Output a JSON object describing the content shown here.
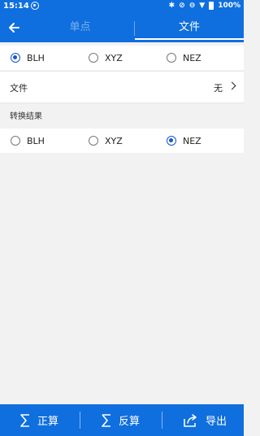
{
  "status_bar": {
    "time": "15:14",
    "battery_pct": "100%",
    "icons": [
      "sync-icon",
      "bluetooth-icon",
      "notifications-off-icon",
      "do-not-disturb-icon",
      "wifi-icon",
      "battery-icon"
    ]
  },
  "nav": {
    "tabs": [
      {
        "label": "单点",
        "active": false
      },
      {
        "label": "文件",
        "active": true
      }
    ]
  },
  "input_format": {
    "options": [
      "BLH",
      "XYZ",
      "NEZ"
    ],
    "selected": "BLH"
  },
  "file_row": {
    "label": "文件",
    "value": "无"
  },
  "result_section": {
    "title": "转换结果",
    "options": [
      "BLH",
      "XYZ",
      "NEZ"
    ],
    "selected": "NEZ"
  },
  "bottom_bar": {
    "forward_label": "正算",
    "inverse_label": "反算",
    "export_label": "导出"
  },
  "colors": {
    "primary": "#0f6fde",
    "radio_selected": "#1656d1",
    "background": "#f2f2f2"
  }
}
